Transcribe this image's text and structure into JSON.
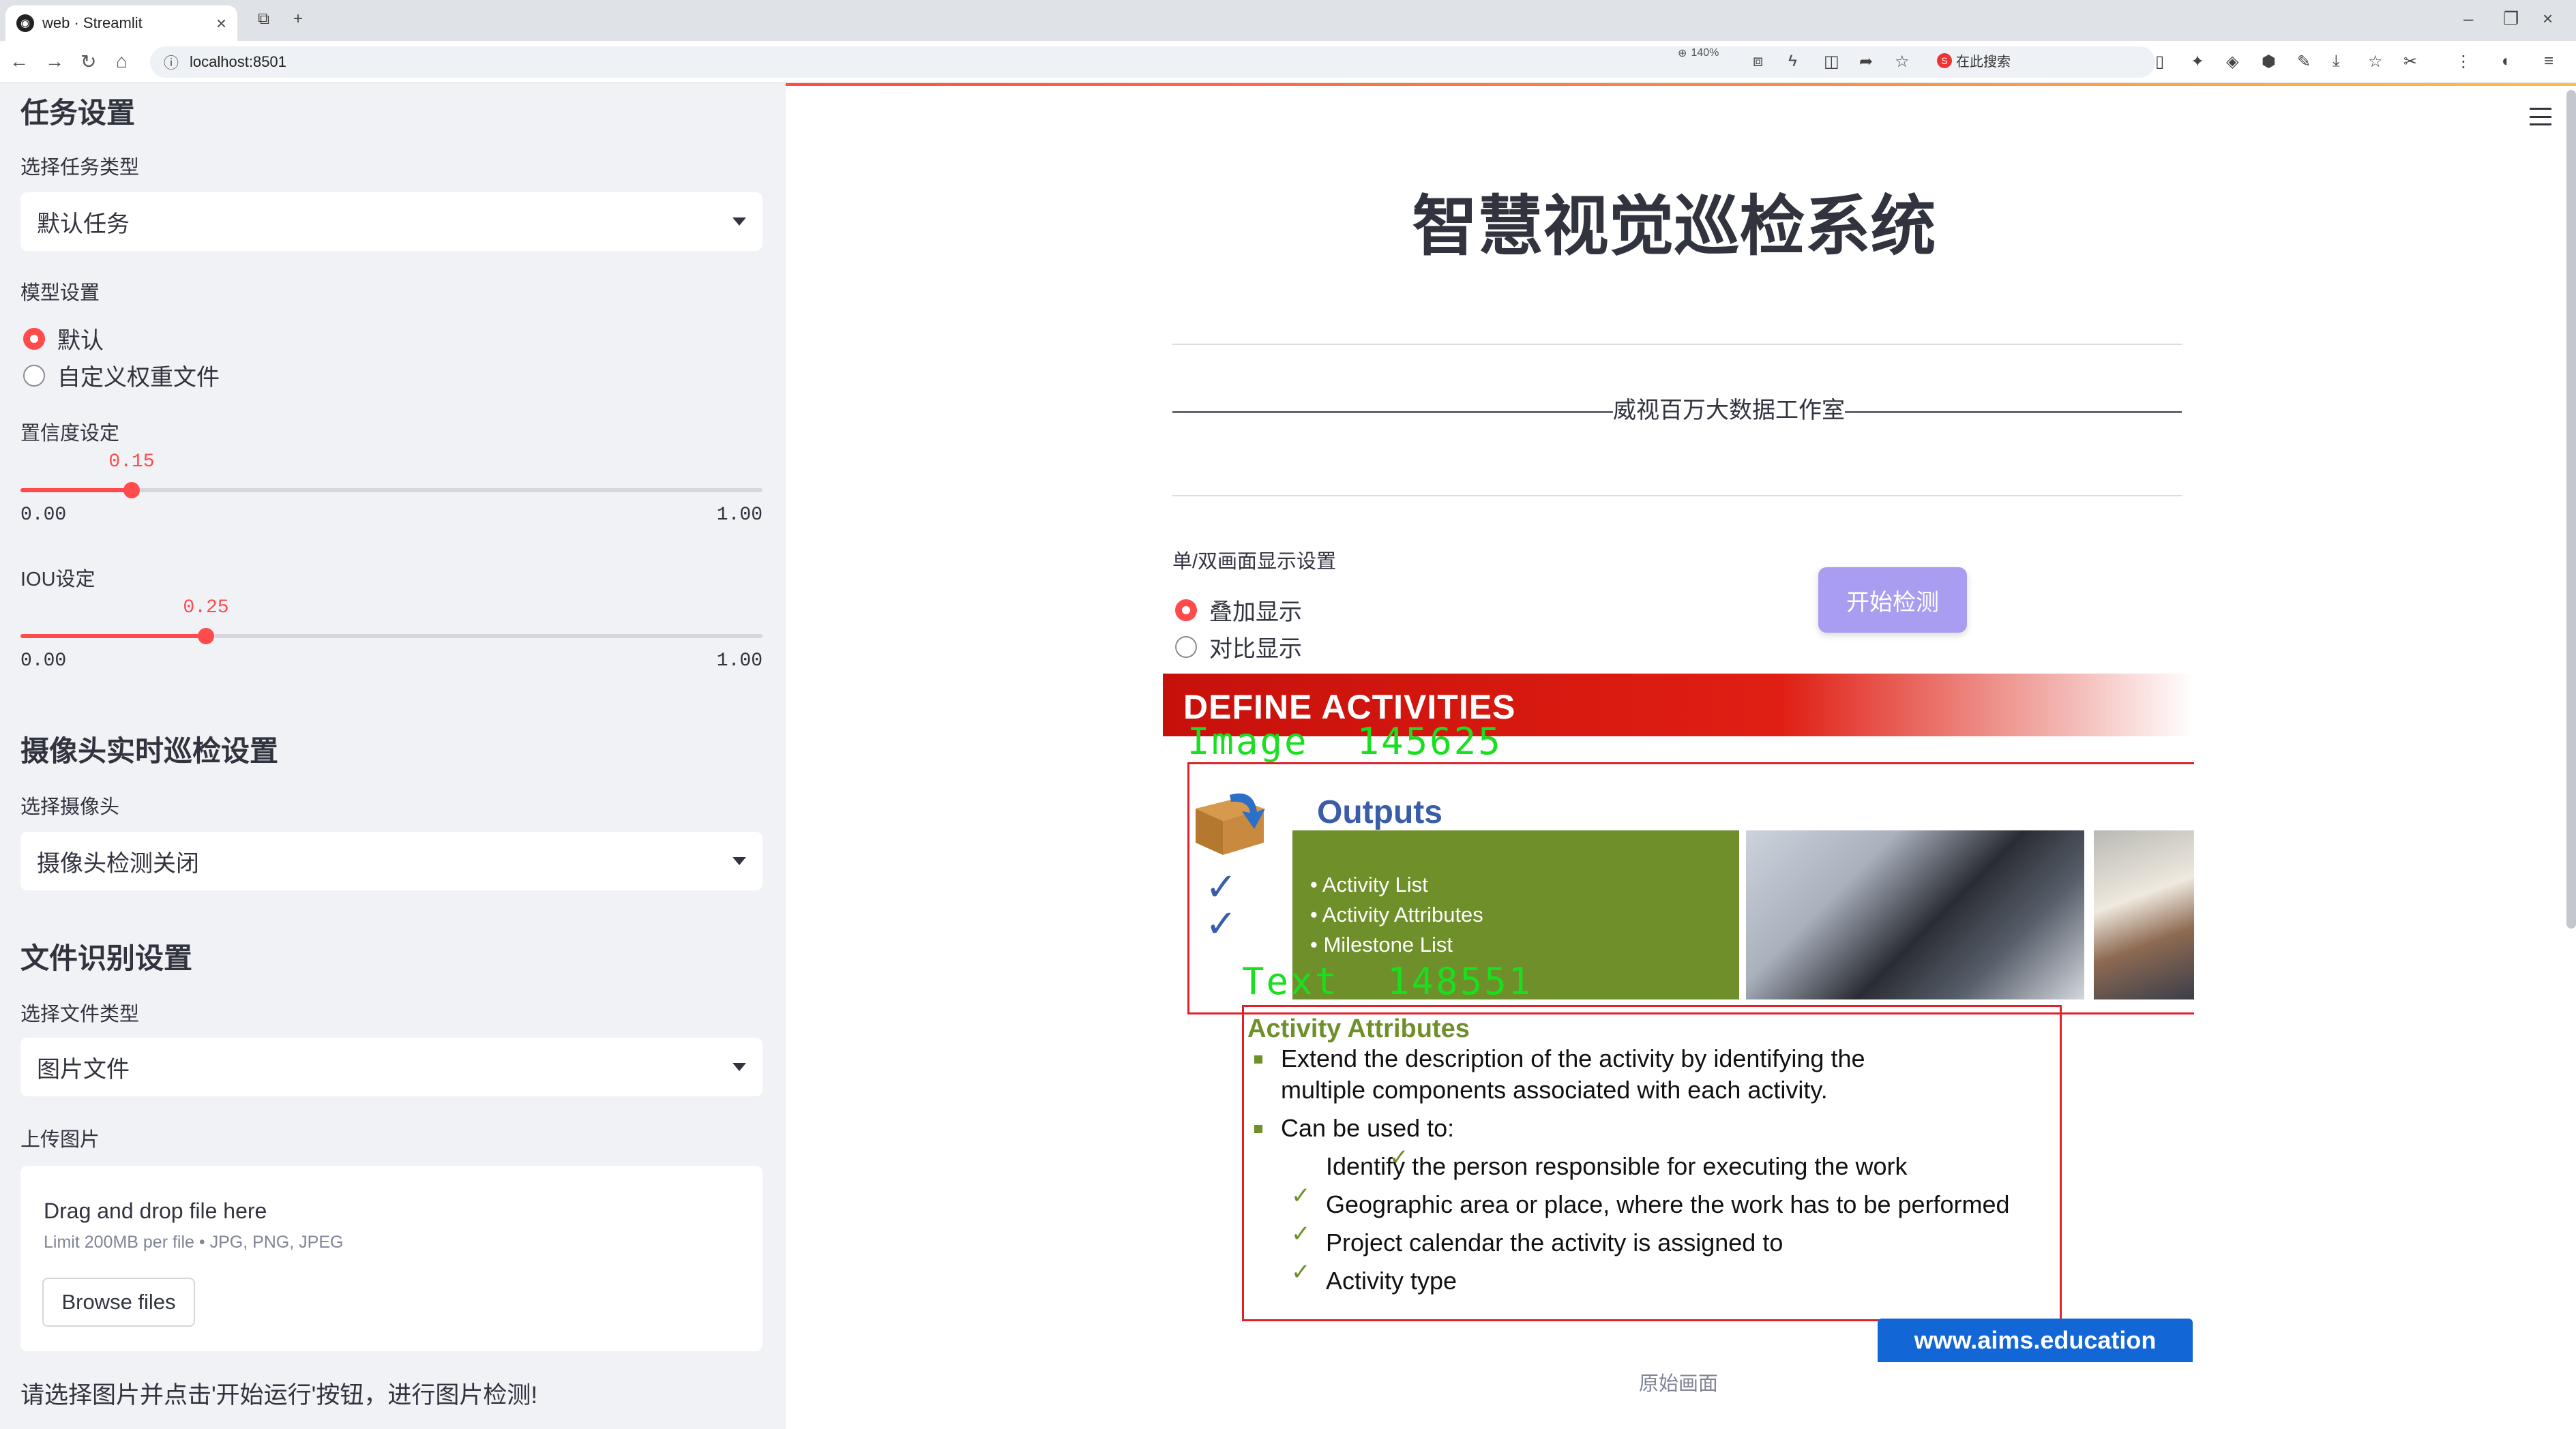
{
  "browser": {
    "tab_title": "web · Streamlit",
    "url": "localhost:8501",
    "zoom": "140%",
    "search_placeholder": "在此搜索"
  },
  "sidebar": {
    "task_heading": "任务设置",
    "task_type_label": "选择任务类型",
    "task_type_value": "默认任务",
    "model_label": "模型设置",
    "model_options": [
      "默认",
      "自定义权重文件"
    ],
    "model_selected": "默认",
    "confidence": {
      "label": "置信度设定",
      "value": "0.15",
      "fraction": 0.15,
      "min": "0.00",
      "max": "1.00"
    },
    "iou": {
      "label": "IOU设定",
      "value": "0.25",
      "fraction": 0.25,
      "min": "0.00",
      "max": "1.00"
    },
    "camera_heading": "摄像头实时巡检设置",
    "camera_label": "选择摄像头",
    "camera_value": "摄像头检测关闭",
    "file_heading": "文件识别设置",
    "file_type_label": "选择文件类型",
    "file_type_value": "图片文件",
    "upload_label": "上传图片",
    "upload": {
      "title": "Drag and drop file here",
      "limit": "Limit 200MB per file • JPG, PNG, JPEG",
      "browse": "Browse files"
    },
    "note": "请选择图片并点击'开始运行'按钮，进行图片检测!"
  },
  "main": {
    "title": "智慧视觉巡检系统",
    "subtitle": "———————————————————威视百万大数据工作室————————————————————",
    "display_mode_label": "单/双画面显示设置",
    "display_options": [
      "叠加显示",
      "对比显示"
    ],
    "display_selected": "叠加显示",
    "start_button": "开始检测",
    "caption": "原始画面"
  },
  "detection_image": {
    "header": "DEFINE ACTIVITIES",
    "detections": [
      {
        "label": "Image",
        "id": "145625"
      },
      {
        "label": "Text",
        "id": "148551"
      }
    ],
    "outputs_title": "Outputs",
    "outputs_list": [
      "Activity List",
      "Activity Attributes",
      "Milestone List"
    ],
    "attributes_title": "Activity Attributes",
    "bullet1": "Extend the description of the activity by identifying the",
    "bullet1_cont": "multiple components associated with each activity.",
    "bullet2": "Can be used to:",
    "sub_items": [
      "Identify the person responsible for executing the work",
      "Geographic area or place, where the work has to be performed",
      "Project calendar the activity is assigned to",
      "Activity type"
    ],
    "badge": "www.aims.education",
    "colors": {
      "box": "#e0212c",
      "label": "#18e01f",
      "accent": "#6f8f2a",
      "header": "#c8100b"
    }
  },
  "theme": {
    "primary": "#ff4b4b",
    "button": "#a89df0",
    "sidebar_bg": "#f0f2f6"
  }
}
